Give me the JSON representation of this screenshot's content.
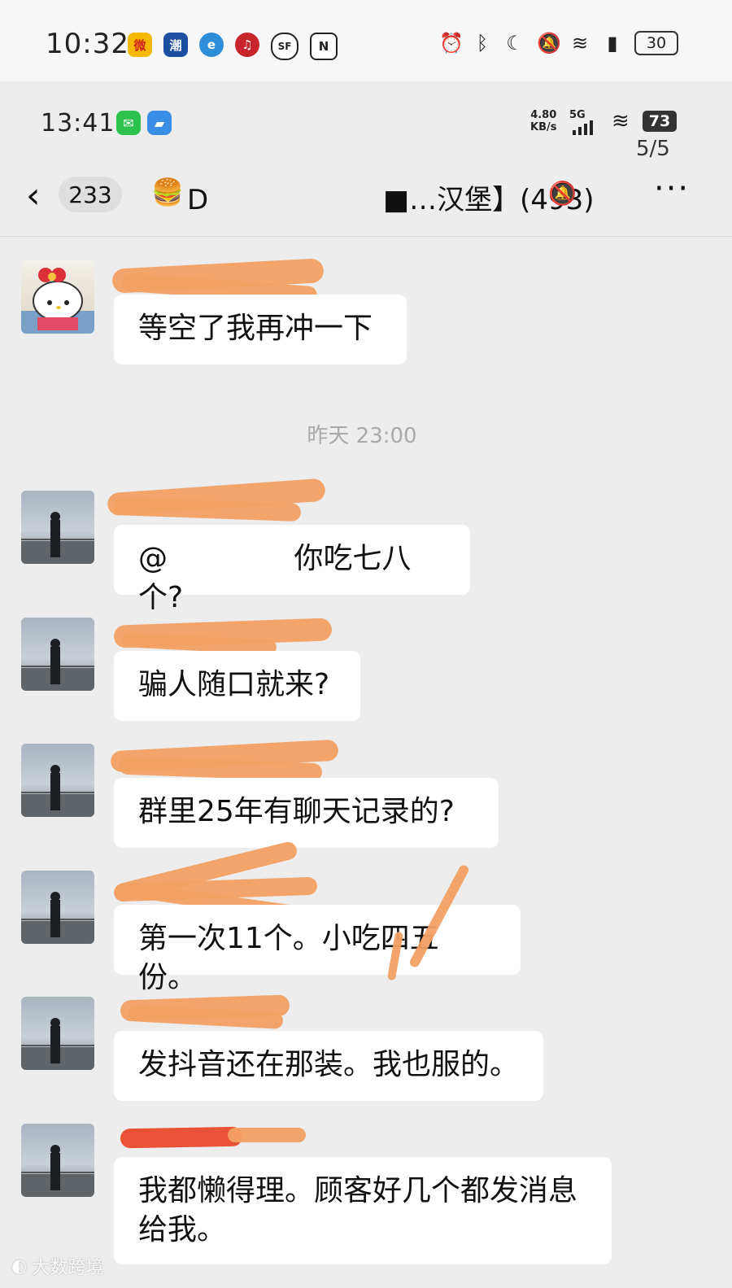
{
  "outer_status": {
    "time": "10:32",
    "battery": "30",
    "app_icons": [
      "weibo-icon",
      "news-icon",
      "browser-icon",
      "music-icon",
      "sf-express-icon",
      "nfc-icon"
    ],
    "sys_icons": [
      "alarm-icon",
      "bluetooth-icon",
      "moon-icon",
      "mute-icon",
      "wifi-icon",
      "signal-icon"
    ]
  },
  "inner_status": {
    "time": "13:41",
    "speed_value": "4.80",
    "speed_unit": "KB/s",
    "network": "5G",
    "battery": "73",
    "page_count": "5/5"
  },
  "header": {
    "back_count": "233",
    "group_emoji": "🍔",
    "group_title": "D　　　　　　 ■…汉堡】(493)"
  },
  "messages": [
    {
      "avatar": "hello-kitty",
      "text": "等空了我再冲一下"
    },
    {
      "avatar": "man",
      "text": "@　　　　  你吃七八个?"
    },
    {
      "avatar": "man",
      "text": "骗人随口就来?"
    },
    {
      "avatar": "man",
      "text": "群里25年有聊天记录的?"
    },
    {
      "avatar": "man",
      "text": "第一次11个。小吃四五份。"
    },
    {
      "avatar": "man",
      "text": "发抖音还在那装。我也服的。"
    },
    {
      "avatar": "man",
      "text": "我都懒得理。顾客好几个都发消息给我。"
    }
  ],
  "timestamp": "昨天 23:00",
  "watermark": "大数跨境",
  "colors": {
    "background": "#ededed",
    "bubble": "#ffffff",
    "redaction": "#f2a063",
    "redaction_red": "#ea4a2e"
  }
}
